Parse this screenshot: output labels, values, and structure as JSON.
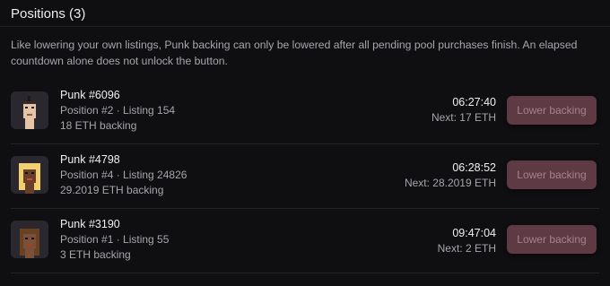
{
  "positions": {
    "title": "Positions (3)",
    "notice": "Like lowering your own listings, Punk backing can only be lowered after all pending pool purchases finish. An elapsed countdown alone does not unlock the button.",
    "button_label": "Lower backing",
    "items": [
      {
        "name": "Punk #6096",
        "position_listing": "Position #2 · Listing 154",
        "backing": "18 ETH backing",
        "countdown": "06:27:40",
        "next": "Next: 17 ETH",
        "avatar": "punk-6096"
      },
      {
        "name": "Punk #4798",
        "position_listing": "Position #4 · Listing 24826",
        "backing": "29.2019 ETH backing",
        "countdown": "06:28:52",
        "next": "Next: 28.2019 ETH",
        "avatar": "punk-4798"
      },
      {
        "name": "Punk #3190",
        "position_listing": "Position #1 · Listing 55",
        "backing": "3 ETH backing",
        "countdown": "09:47:04",
        "next": "Next: 2 ETH",
        "avatar": "punk-3190"
      }
    ]
  },
  "colors": {
    "background": "#0f0e11",
    "button_disabled_bg": "#5e3b44",
    "button_disabled_text": "#a5838b",
    "muted_text": "#a8a5ac"
  }
}
